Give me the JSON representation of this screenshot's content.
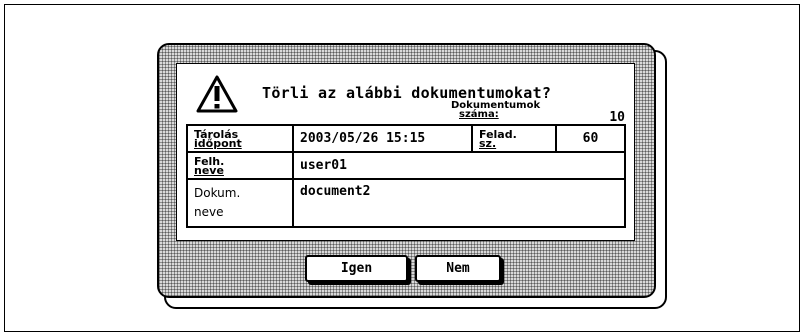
{
  "dialog": {
    "title": "Törli az alábbi dokumentumokat?",
    "count_label_line1": "Dokumentumok",
    "count_label_line2": "száma:",
    "count_value": "10",
    "rows": [
      {
        "label_line1": "Tárolás",
        "label_line2": "időpont",
        "value": "2003/05/26  15:15",
        "extra_label_line1": "Felad.",
        "extra_label_line2": "sz.",
        "extra_value": "60"
      },
      {
        "label_line1": "Felh.",
        "label_line2": "neve",
        "value": "user01"
      },
      {
        "label_line1": "Dokum.",
        "label_line2": "neve",
        "value": "document2"
      }
    ],
    "buttons": {
      "yes": "Igen",
      "no": "Nem"
    },
    "icon": "warning-triangle-icon"
  }
}
